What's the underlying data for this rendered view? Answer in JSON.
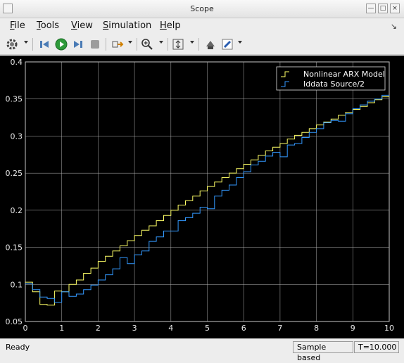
{
  "window": {
    "title": "Scope"
  },
  "menu": [
    {
      "label": "File",
      "mnemonic": "F",
      "rest": "ile"
    },
    {
      "label": "Tools",
      "mnemonic": "T",
      "rest": "ools"
    },
    {
      "label": "View",
      "mnemonic": "V",
      "rest": "iew"
    },
    {
      "label": "Simulation",
      "mnemonic": "S",
      "rest": "imulation"
    },
    {
      "label": "Help",
      "mnemonic": "H",
      "rest": "elp"
    }
  ],
  "toolbar": {
    "icons": [
      "gear-icon",
      "step-back-icon",
      "run-icon",
      "step-forward-icon",
      "stop-icon",
      "signal-select-icon",
      "zoom-icon",
      "autoscale-icon",
      "highlight-block-icon",
      "style-icon"
    ]
  },
  "status": {
    "left": "Ready",
    "mode": "Sample based",
    "time": "T=10.000"
  },
  "colors": {
    "series1": "#ffff66",
    "series2": "#3399ff",
    "axes_bg": "#000000",
    "grid": "#b8b8b8"
  },
  "chart_data": {
    "type": "line",
    "title": "",
    "xlabel": "",
    "ylabel": "",
    "xlim": [
      0,
      10
    ],
    "ylim": [
      0.05,
      0.4
    ],
    "xticks": [
      "0",
      "1",
      "2",
      "3",
      "4",
      "5",
      "6",
      "7",
      "8",
      "9",
      "10"
    ],
    "yticks": [
      "0.05",
      "0.1",
      "0.15",
      "0.2",
      "0.25",
      "0.3",
      "0.35",
      "0.4"
    ],
    "grid": true,
    "legend_position": "top-right",
    "step": true,
    "x": [
      0,
      0.2,
      0.4,
      0.6,
      0.8,
      1,
      1.2,
      1.4,
      1.6,
      1.8,
      2,
      2.2,
      2.4,
      2.6,
      2.8,
      3,
      3.2,
      3.4,
      3.6,
      3.8,
      4,
      4.2,
      4.4,
      4.6,
      4.8,
      5,
      5.2,
      5.4,
      5.6,
      5.8,
      6,
      6.2,
      6.4,
      6.6,
      6.8,
      7,
      7.2,
      7.4,
      7.6,
      7.8,
      8,
      8.2,
      8.4,
      8.6,
      8.8,
      9,
      9.2,
      9.4,
      9.6,
      9.8
    ],
    "series": [
      {
        "name": "Nonlinear ARX Model",
        "values": [
          0.103,
          0.09,
          0.073,
          0.072,
          0.091,
          0.09,
          0.1,
          0.106,
          0.115,
          0.122,
          0.131,
          0.138,
          0.145,
          0.152,
          0.159,
          0.166,
          0.173,
          0.179,
          0.186,
          0.193,
          0.2,
          0.207,
          0.213,
          0.219,
          0.226,
          0.232,
          0.238,
          0.244,
          0.25,
          0.256,
          0.262,
          0.268,
          0.274,
          0.28,
          0.285,
          0.29,
          0.296,
          0.301,
          0.305,
          0.31,
          0.315,
          0.319,
          0.323,
          0.328,
          0.332,
          0.336,
          0.34,
          0.345,
          0.349,
          0.353
        ]
      },
      {
        "name": "Iddata Source/2",
        "values": [
          0.101,
          0.093,
          0.083,
          0.081,
          0.076,
          0.09,
          0.084,
          0.087,
          0.093,
          0.099,
          0.106,
          0.113,
          0.121,
          0.136,
          0.128,
          0.14,
          0.145,
          0.158,
          0.164,
          0.172,
          0.172,
          0.186,
          0.19,
          0.196,
          0.204,
          0.202,
          0.219,
          0.227,
          0.234,
          0.244,
          0.252,
          0.261,
          0.266,
          0.273,
          0.278,
          0.272,
          0.288,
          0.29,
          0.298,
          0.305,
          0.31,
          0.318,
          0.321,
          0.32,
          0.33,
          0.337,
          0.342,
          0.347,
          0.35,
          0.355
        ]
      }
    ]
  }
}
